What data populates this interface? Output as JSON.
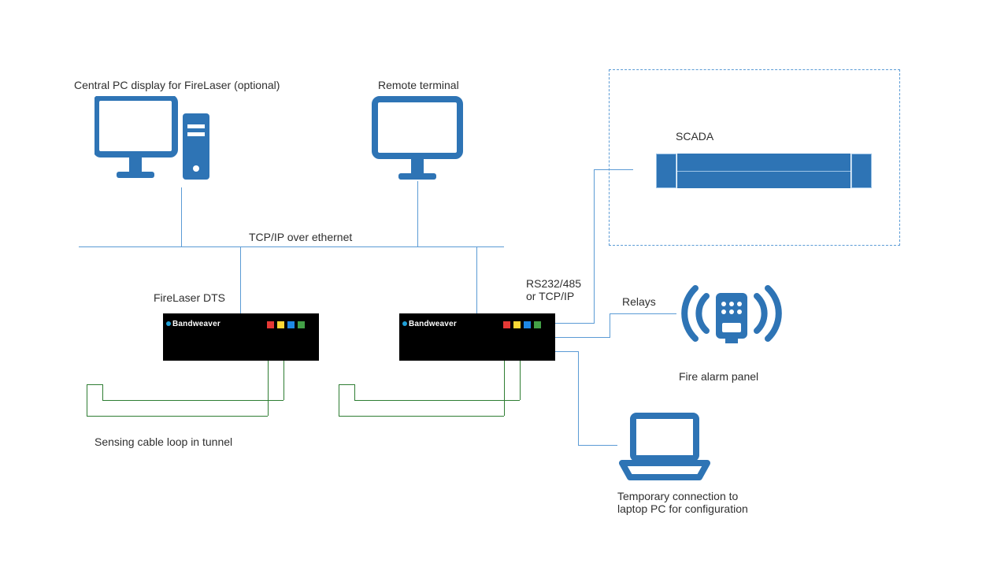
{
  "labels": {
    "central_pc": "Central PC display for FireLaser (optional)",
    "remote_terminal": "Remote terminal",
    "scada": "SCADA",
    "tcpip": "TCP/IP over ethernet",
    "firelaser_dts": "FireLaser DTS",
    "rs232": "RS232/485\nor TCP/IP",
    "relays": "Relays",
    "fire_alarm_panel": "Fire alarm panel",
    "sensing_cable": "Sensing cable loop in tunnel",
    "laptop": "Temporary connection to\nlaptop PC for configuration"
  },
  "devices": {
    "dts_brand": "Bandweaver"
  },
  "palette": {
    "blue": "#2e74b5",
    "light_blue": "#5b9bd5",
    "green": "#2e7d32"
  }
}
